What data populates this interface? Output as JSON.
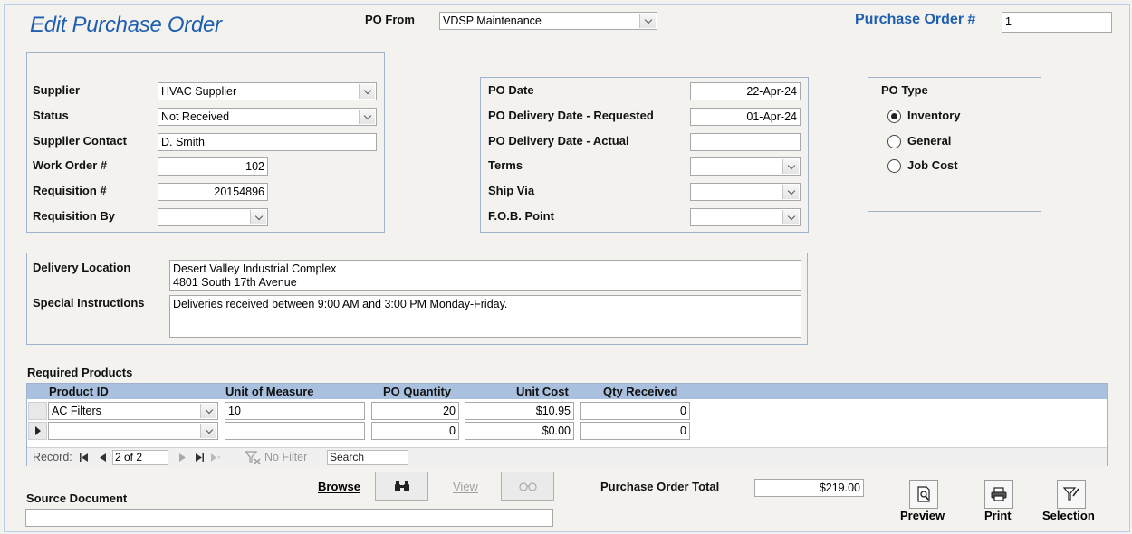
{
  "title": "Edit Purchase Order",
  "po_from": {
    "label": "PO From",
    "value": "VDSP Maintenance"
  },
  "po_number": {
    "label": "Purchase Order #",
    "value": "1"
  },
  "left_panel": {
    "supplier": {
      "label": "Supplier",
      "value": "HVAC Supplier"
    },
    "status": {
      "label": "Status",
      "value": "Not Received"
    },
    "supplier_contact": {
      "label": "Supplier Contact",
      "value": "D. Smith"
    },
    "work_order": {
      "label": "Work Order #",
      "value": "102"
    },
    "requisition": {
      "label": "Requisition #",
      "value": "20154896"
    },
    "requisition_by": {
      "label": "Requisition By",
      "value": ""
    }
  },
  "mid_panel": {
    "po_date": {
      "label": "PO Date",
      "value": "22-Apr-24"
    },
    "delivery_requested": {
      "label": "PO Delivery Date - Requested",
      "value": "01-Apr-24"
    },
    "delivery_actual": {
      "label": "PO Delivery Date - Actual",
      "value": ""
    },
    "terms": {
      "label": "Terms",
      "value": ""
    },
    "ship_via": {
      "label": "Ship Via",
      "value": ""
    },
    "fob_point": {
      "label": "F.O.B. Point",
      "value": ""
    }
  },
  "po_type": {
    "label": "PO Type",
    "options": [
      "Inventory",
      "General",
      "Job Cost"
    ],
    "selected": "Inventory"
  },
  "delivery": {
    "location_label": "Delivery Location",
    "location_line1": "Desert Valley Industrial Complex",
    "location_line2": "4801 South 17th Avenue",
    "instructions_label": "Special Instructions",
    "instructions": "Deliveries received between 9:00 AM and 3:00 PM Monday-Friday."
  },
  "products": {
    "label": "Required Products",
    "columns": [
      "Product ID",
      "Unit of Measure",
      "PO Quantity",
      "Unit Cost",
      "Qty Received"
    ],
    "rows": [
      {
        "product_id": "AC Filters",
        "uom": "10",
        "qty": "20",
        "unit_cost": "$10.95",
        "qty_received": "0"
      },
      {
        "product_id": "",
        "uom": "",
        "qty": "0",
        "unit_cost": "$0.00",
        "qty_received": "0"
      }
    ],
    "nav": {
      "record_label": "Record:",
      "position": "2 of 2",
      "no_filter": "No Filter",
      "search": "Search"
    }
  },
  "bottom": {
    "browse_label": "Browse",
    "view_label": "View",
    "source_document_label": "Source Document",
    "source_document_value": "",
    "total_label": "Purchase Order Total",
    "total_value": "$219.00",
    "preview_label": "Preview",
    "print_label": "Print",
    "selection_label": "Selection"
  },
  "colors": {
    "accent": "#1f5fb0",
    "grid_header": "#a9c1de",
    "border": "#9fb3cc"
  }
}
